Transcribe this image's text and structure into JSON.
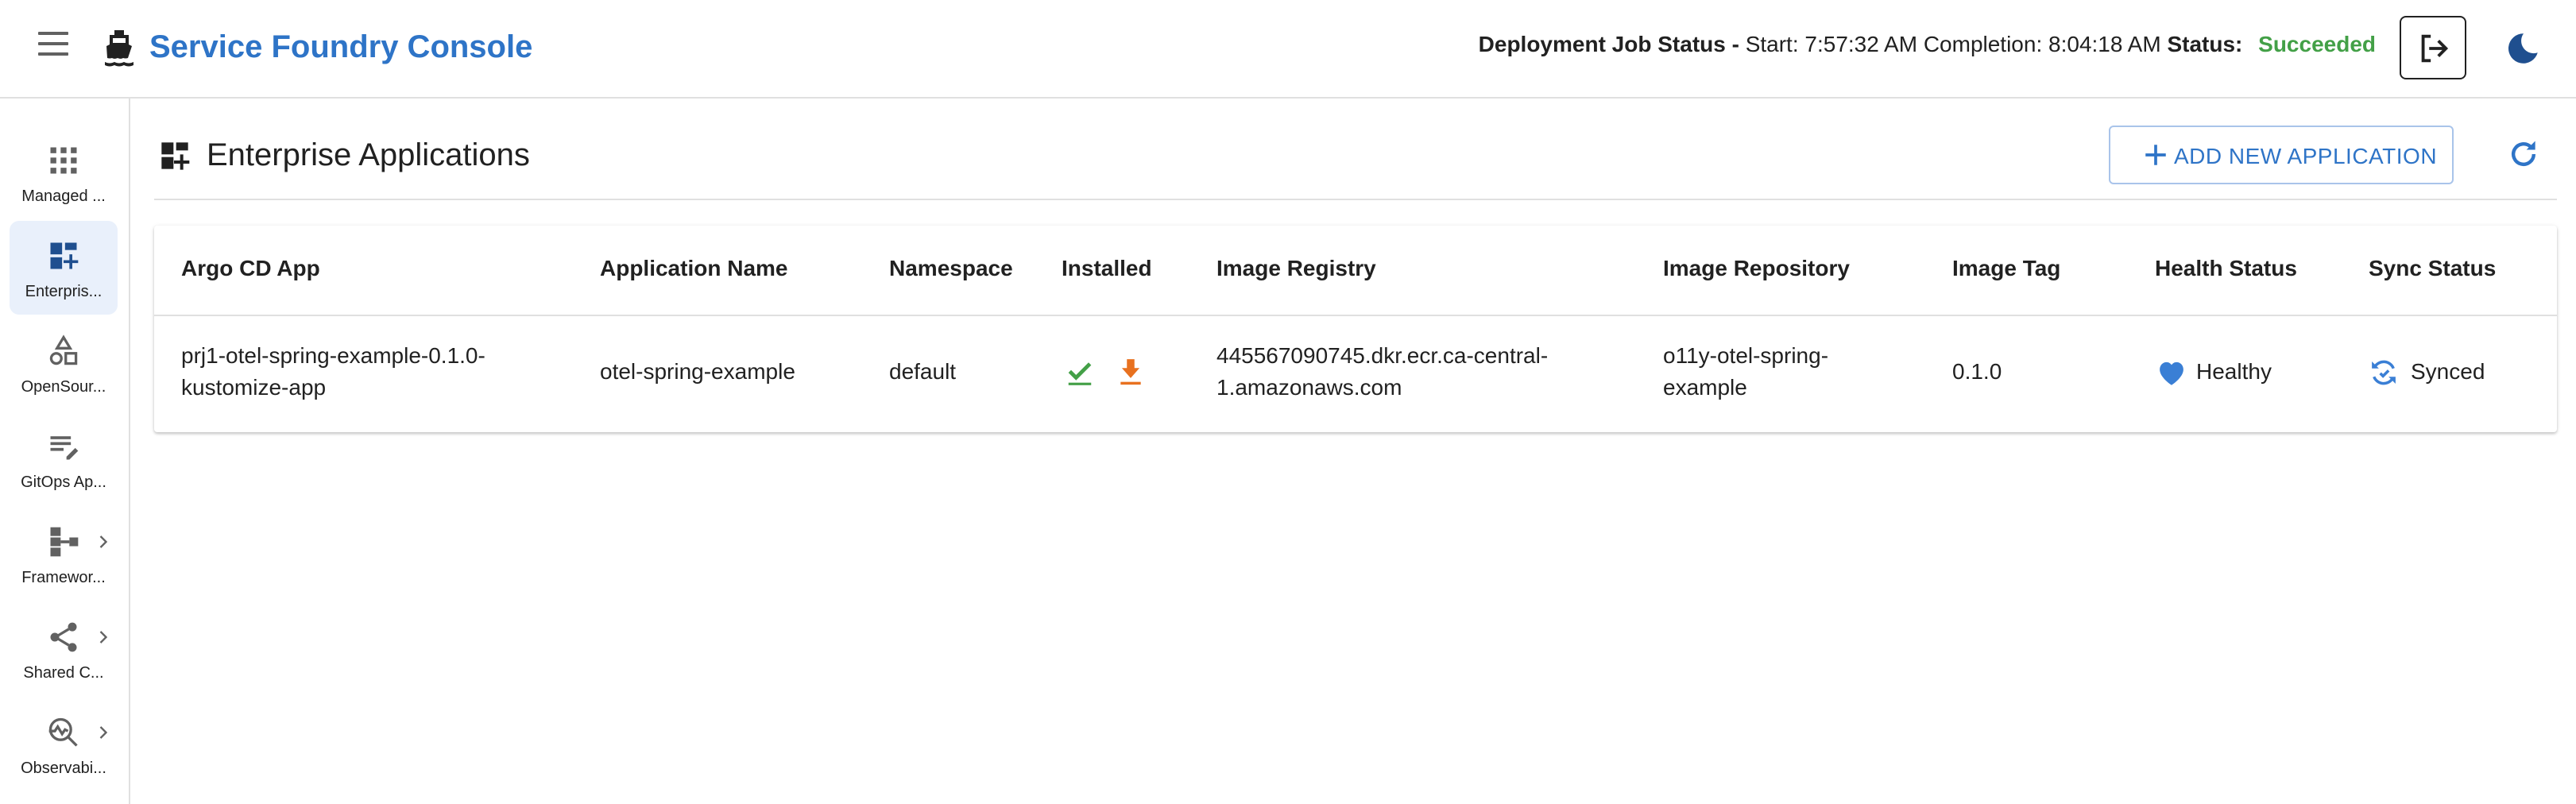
{
  "header": {
    "app_title": "Service Foundry Console",
    "job_status": {
      "label": "Deployment Job Status -",
      "start": "Start: 7:57:32 AM",
      "completion": "Completion: 8:04:18 AM",
      "status_label": "Status:",
      "status_value": "Succeeded"
    },
    "icons": {
      "menu": "menu-icon",
      "logo": "ship-icon",
      "logout": "logout-icon",
      "theme": "moon-icon"
    }
  },
  "sidebar": {
    "items": [
      {
        "label": "Managed ...",
        "icon": "apps-grid-icon",
        "active": false,
        "has_submenu": false
      },
      {
        "label": "Enterpris...",
        "icon": "dashboard-add-icon",
        "active": true,
        "has_submenu": false
      },
      {
        "label": "OpenSour...",
        "icon": "category-shapes-icon",
        "active": false,
        "has_submenu": false
      },
      {
        "label": "GitOps Ap...",
        "icon": "edit-note-icon",
        "active": false,
        "has_submenu": false
      },
      {
        "label": "Framewor...",
        "icon": "account-tree-icon",
        "active": false,
        "has_submenu": true
      },
      {
        "label": "Shared C...",
        "icon": "share-icon",
        "active": false,
        "has_submenu": true
      },
      {
        "label": "Observabi...",
        "icon": "query-stats-icon",
        "active": false,
        "has_submenu": true
      }
    ]
  },
  "main": {
    "title": "Enterprise Applications",
    "add_button_label": "ADD NEW APPLICATION",
    "table": {
      "headers": [
        "Argo CD App",
        "Application Name",
        "Namespace",
        "Installed",
        "Image Registry",
        "Image Repository",
        "Image Tag",
        "Health Status",
        "Sync Status"
      ],
      "rows": [
        {
          "argo_app_line1": "prj1-otel-spring-example-0.1.0-",
          "argo_app_line2": "kustomize-app",
          "application_name": "otel-spring-example",
          "namespace": "default",
          "installed_icons": [
            "check-icon",
            "download-icon"
          ],
          "registry_line1": "445567090745.dkr.ecr.ca-central-",
          "registry_line2": "1.amazonaws.com",
          "repository_line1": "o11y-otel-spring-",
          "repository_line2": "example",
          "image_tag": "0.1.0",
          "health_status": "Healthy",
          "sync_status": "Synced"
        }
      ]
    }
  },
  "colors": {
    "brand_blue": "#2e74c7",
    "success_green": "#43a047",
    "download_orange": "#e8711f",
    "health_blue": "#3a7fd5",
    "active_nav_bg": "#e9f0fb",
    "icon_grey": "#616161"
  }
}
